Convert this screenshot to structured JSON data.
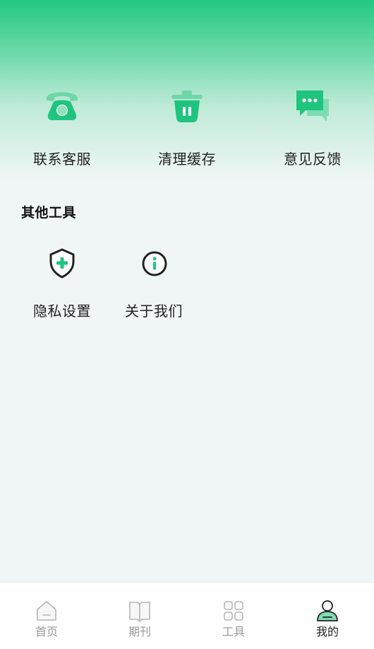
{
  "quick_actions": [
    {
      "label": "联系客服",
      "icon": "phone-icon"
    },
    {
      "label": "清理缓存",
      "icon": "trash-icon"
    },
    {
      "label": "意见反馈",
      "icon": "chat-icon"
    }
  ],
  "other_tools": {
    "title": "其他工具",
    "items": [
      {
        "label": "隐私设置",
        "icon": "shield-icon"
      },
      {
        "label": "关于我们",
        "icon": "info-icon"
      }
    ]
  },
  "tabbar": {
    "items": [
      {
        "label": "首页",
        "icon": "home-icon"
      },
      {
        "label": "期刊",
        "icon": "book-icon"
      },
      {
        "label": "工具",
        "icon": "grid-icon"
      },
      {
        "label": "我的",
        "icon": "user-icon",
        "active": true
      }
    ]
  },
  "colors": {
    "accent": "#1fc47e",
    "accent_light": "#7edcb3",
    "text": "#222222",
    "tab_inactive": "#9a9a9a"
  }
}
